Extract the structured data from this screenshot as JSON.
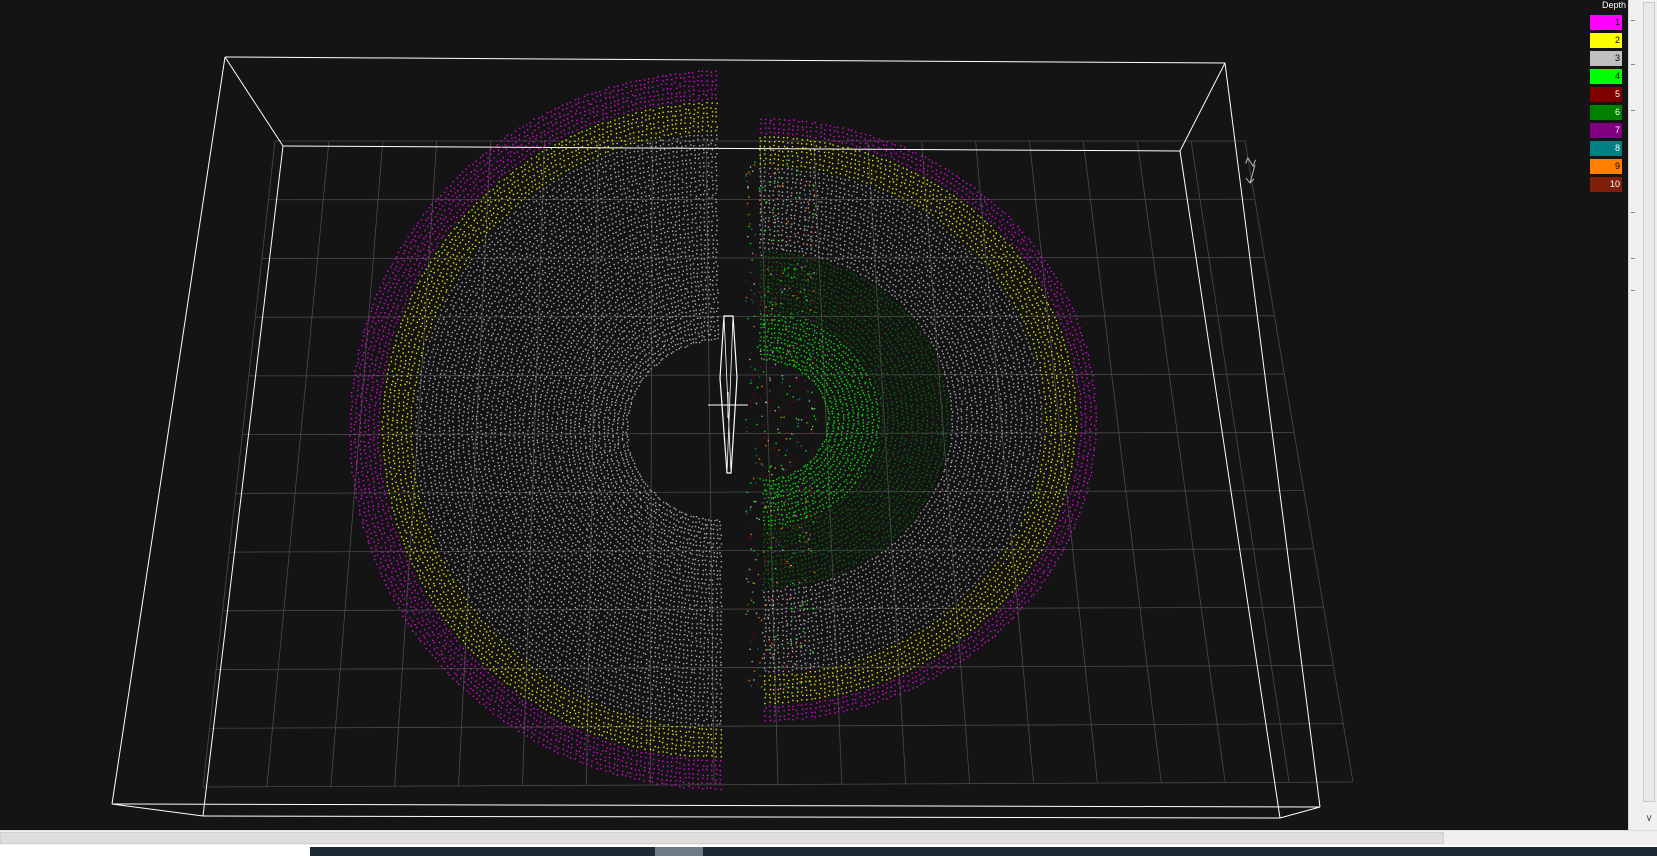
{
  "legend": {
    "title": "Depth",
    "items": [
      {
        "label": "1",
        "color": "#ff00ff",
        "text_color": "#000000"
      },
      {
        "label": "2",
        "color": "#ffff00",
        "text_color": "#000000"
      },
      {
        "label": "3",
        "color": "#c0c0c0",
        "text_color": "#000000"
      },
      {
        "label": "4",
        "color": "#00ff00",
        "text_color": "#000000"
      },
      {
        "label": "5",
        "color": "#800000",
        "text_color": "#ffffff"
      },
      {
        "label": "6",
        "color": "#008000",
        "text_color": "#ffffff"
      },
      {
        "label": "7",
        "color": "#800080",
        "text_color": "#ffffff"
      },
      {
        "label": "8",
        "color": "#008080",
        "text_color": "#ffffff"
      },
      {
        "label": "9",
        "color": "#ff8000",
        "text_color": "#000000"
      },
      {
        "label": "10",
        "color": "#80200c",
        "text_color": "#ffffff"
      }
    ]
  },
  "viewport": {
    "background": "#141414",
    "box_color": "#ffffff",
    "grid_color": "#4a4a4a",
    "axis_label": "Z",
    "shapes": [
      "sphere-point-cloud",
      "sensor-model",
      "north-arrow-icon"
    ]
  }
}
